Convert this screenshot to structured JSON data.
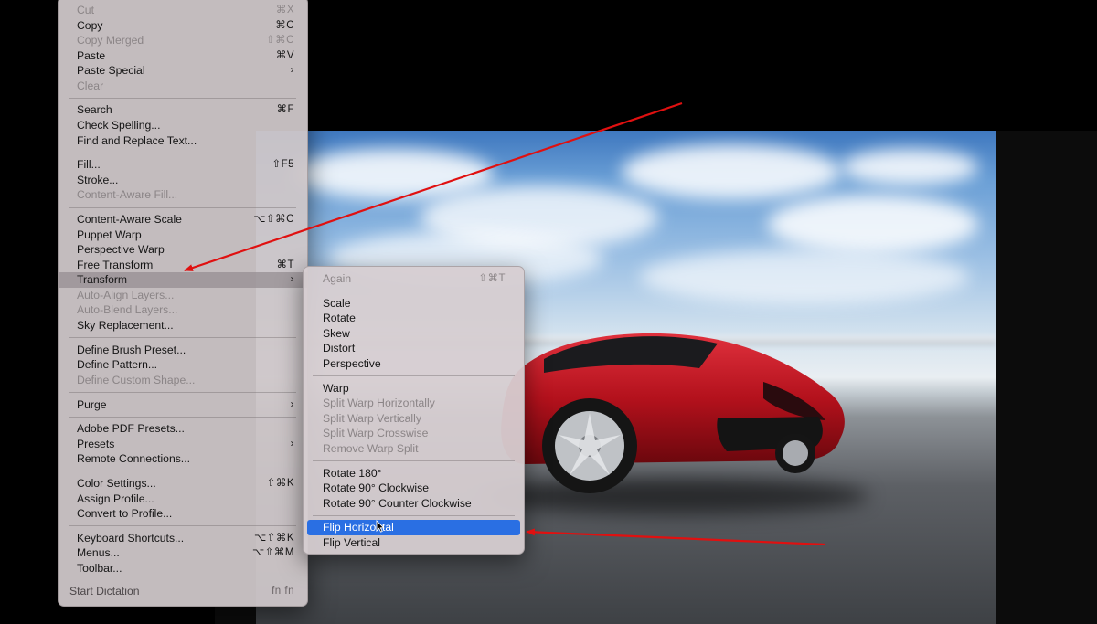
{
  "edit_menu": {
    "items": [
      {
        "label": "Cut",
        "shortcut": "⌘X",
        "disabled": true
      },
      {
        "label": "Copy",
        "shortcut": "⌘C"
      },
      {
        "label": "Copy Merged",
        "shortcut": "⇧⌘C",
        "disabled": true
      },
      {
        "label": "Paste",
        "shortcut": "⌘V"
      },
      {
        "label": "Paste Special",
        "shortcut": "›"
      },
      {
        "label": "Clear",
        "shortcut": "",
        "disabled": true
      },
      {
        "sep": true
      },
      {
        "label": "Search",
        "shortcut": "⌘F"
      },
      {
        "label": "Check Spelling...",
        "shortcut": ""
      },
      {
        "label": "Find and Replace Text...",
        "shortcut": ""
      },
      {
        "sep": true
      },
      {
        "label": "Fill...",
        "shortcut": "⇧F5"
      },
      {
        "label": "Stroke...",
        "shortcut": ""
      },
      {
        "label": "Content-Aware Fill...",
        "shortcut": "",
        "disabled": true
      },
      {
        "sep": true
      },
      {
        "label": "Content-Aware Scale",
        "shortcut": "⌥⇧⌘C"
      },
      {
        "label": "Puppet Warp",
        "shortcut": ""
      },
      {
        "label": "Perspective Warp",
        "shortcut": ""
      },
      {
        "label": "Free Transform",
        "shortcut": "⌘T"
      },
      {
        "label": "Transform",
        "shortcut": "›",
        "highlight": true
      },
      {
        "label": "Auto-Align Layers...",
        "shortcut": "",
        "disabled": true
      },
      {
        "label": "Auto-Blend Layers...",
        "shortcut": "",
        "disabled": true
      },
      {
        "label": "Sky Replacement...",
        "shortcut": ""
      },
      {
        "sep": true
      },
      {
        "label": "Define Brush Preset...",
        "shortcut": ""
      },
      {
        "label": "Define Pattern...",
        "shortcut": ""
      },
      {
        "label": "Define Custom Shape...",
        "shortcut": "",
        "disabled": true
      },
      {
        "sep": true
      },
      {
        "label": "Purge",
        "shortcut": "›"
      },
      {
        "sep": true
      },
      {
        "label": "Adobe PDF Presets...",
        "shortcut": ""
      },
      {
        "label": "Presets",
        "shortcut": "›"
      },
      {
        "label": "Remote Connections...",
        "shortcut": ""
      },
      {
        "sep": true
      },
      {
        "label": "Color Settings...",
        "shortcut": "⇧⌘K"
      },
      {
        "label": "Assign Profile...",
        "shortcut": ""
      },
      {
        "label": "Convert to Profile...",
        "shortcut": ""
      },
      {
        "sep": true
      },
      {
        "label": "Keyboard Shortcuts...",
        "shortcut": "⌥⇧⌘K"
      },
      {
        "label": "Menus...",
        "shortcut": "⌥⇧⌘M"
      },
      {
        "label": "Toolbar...",
        "shortcut": ""
      }
    ],
    "dictation": {
      "label": "Start Dictation",
      "shortcut": "fn fn"
    }
  },
  "transform_menu": {
    "items": [
      {
        "label": "Again",
        "shortcut": "⇧⌘T",
        "disabled": true
      },
      {
        "sep": true
      },
      {
        "label": "Scale",
        "shortcut": ""
      },
      {
        "label": "Rotate",
        "shortcut": ""
      },
      {
        "label": "Skew",
        "shortcut": ""
      },
      {
        "label": "Distort",
        "shortcut": ""
      },
      {
        "label": "Perspective",
        "shortcut": ""
      },
      {
        "sep": true
      },
      {
        "label": "Warp",
        "shortcut": ""
      },
      {
        "label": "Split Warp Horizontally",
        "shortcut": "",
        "disabled": true
      },
      {
        "label": "Split Warp Vertically",
        "shortcut": "",
        "disabled": true
      },
      {
        "label": "Split Warp Crosswise",
        "shortcut": "",
        "disabled": true
      },
      {
        "label": "Remove Warp Split",
        "shortcut": "",
        "disabled": true
      },
      {
        "sep": true
      },
      {
        "label": "Rotate 180°",
        "shortcut": ""
      },
      {
        "label": "Rotate 90° Clockwise",
        "shortcut": ""
      },
      {
        "label": "Rotate 90° Counter Clockwise",
        "shortcut": ""
      },
      {
        "sep": true
      },
      {
        "label": "Flip Horizontal",
        "shortcut": "",
        "selected": true
      },
      {
        "label": "Flip Vertical",
        "shortcut": ""
      }
    ]
  },
  "colors": {
    "menu_bg": "#cec6c8",
    "selection_blue": "#2a6fe3",
    "annotation_red": "#e01010",
    "car_red": "#b3111c"
  },
  "icons": {
    "pointer": "arrow-cursor-icon"
  }
}
